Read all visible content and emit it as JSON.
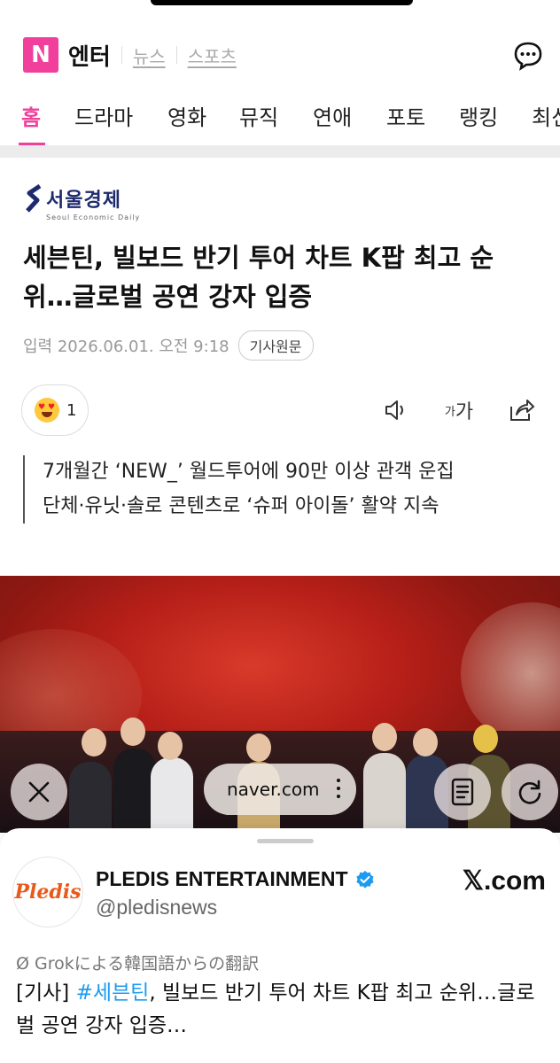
{
  "header": {
    "logo_letter": "N",
    "brand": "엔터",
    "subnav": [
      "뉴스",
      "스포츠"
    ],
    "chat_icon": "chat-bubble-icon"
  },
  "tabs": [
    {
      "label": "홈",
      "active": true
    },
    {
      "label": "드라마"
    },
    {
      "label": "영화"
    },
    {
      "label": "뮤직"
    },
    {
      "label": "연애"
    },
    {
      "label": "포토"
    },
    {
      "label": "랭킹"
    },
    {
      "label": "최신"
    }
  ],
  "article": {
    "press_name": "서울경제",
    "press_sub": "Seoul Economic Daily",
    "headline": "세븐틴, 빌보드 반기 투어 차트 K팝 최고 순위…글로벌 공연 강자 입증",
    "meta": "입력 2026.06.01. 오전 9:18",
    "original_button": "기사원문",
    "reaction_count": "1",
    "font_tool_small": "가",
    "font_tool_large": "가",
    "summary_lines": [
      "7개월간 ‘NEW_’ 월드투어에 90만 이상 관객 운집",
      "단체·유닛·솔로 콘텐츠로 ‘슈퍼 아이돌’ 활약 지속"
    ]
  },
  "browser": {
    "url": "naver.com",
    "close_icon": "close-icon",
    "reader_icon": "reader-icon",
    "reload_icon": "reload-icon"
  },
  "embed": {
    "avatar_text": "Pledis",
    "account_name": "PLEDIS ENTERTAINMENT",
    "handle": "@pledisnews",
    "source": "𝕏.com",
    "translation_note": "Ø Grokによる韓国語からの翻訳",
    "tweet_prefix": "[기사] ",
    "tweet_hashtag": "#세븐틴",
    "tweet_rest": ", 빌보드 반기 투어 차트 K팝 최고 순위…글로벌 공연 강자 입증…"
  },
  "colors": {
    "accent": "#f0409b",
    "press": "#1d2a6d",
    "link": "#1d9bf0"
  }
}
